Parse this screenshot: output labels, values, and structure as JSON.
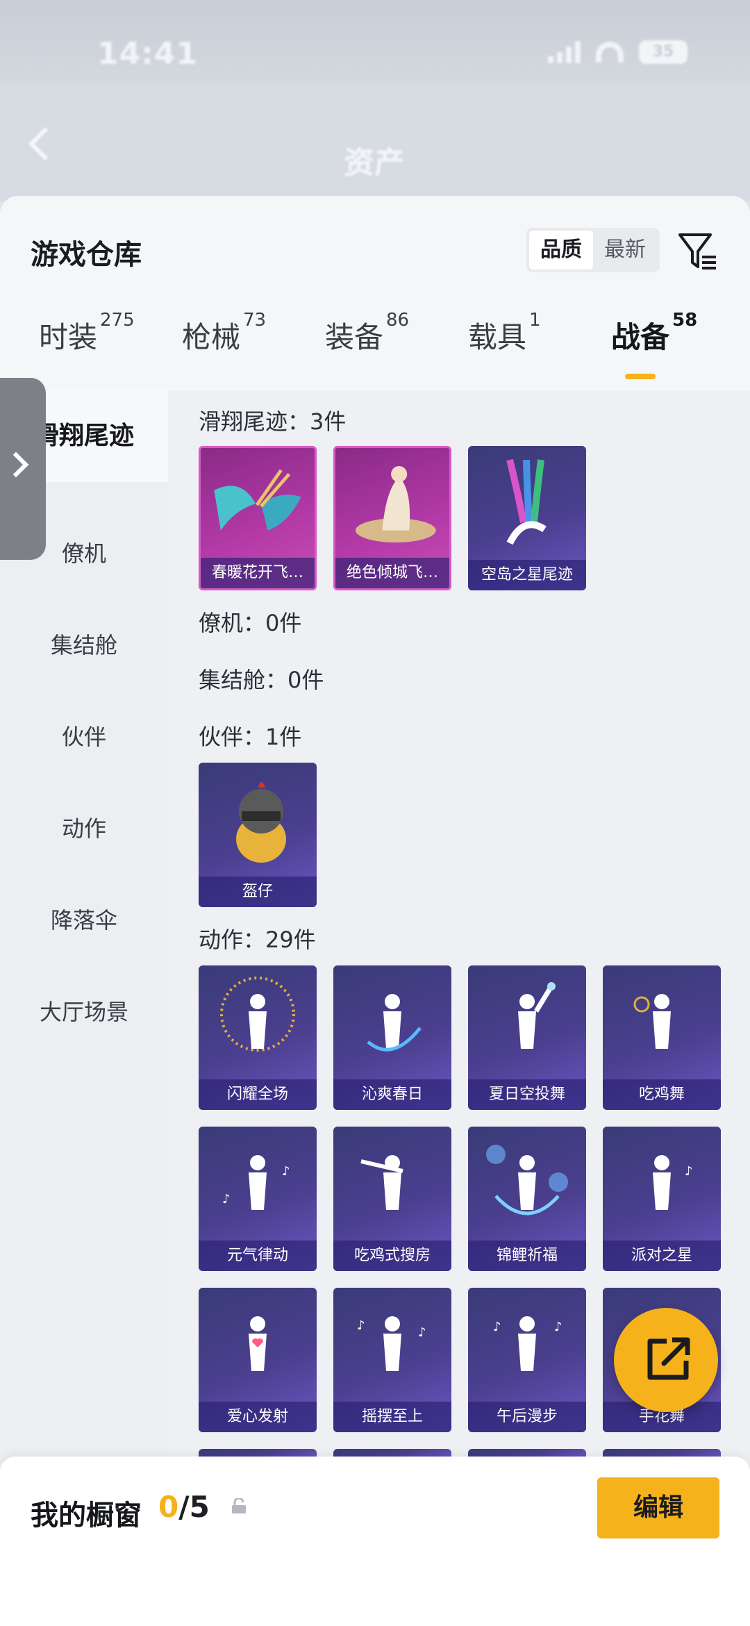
{
  "status": {
    "time": "14:41",
    "battery": "35"
  },
  "nav": {
    "title": "资产"
  },
  "warehouse": {
    "title": "游戏仓库",
    "sort": {
      "quality_label": "品质",
      "latest_label": "最新"
    }
  },
  "tabs": [
    {
      "label": "时装",
      "count": "275"
    },
    {
      "label": "枪械",
      "count": "73"
    },
    {
      "label": "装备",
      "count": "86"
    },
    {
      "label": "载具",
      "count": "1"
    },
    {
      "label": "战备",
      "count": "58"
    }
  ],
  "sidebar": {
    "items": [
      {
        "label": "滑翔尾迹"
      },
      {
        "label": "僚机"
      },
      {
        "label": "集结舱"
      },
      {
        "label": "伙伴"
      },
      {
        "label": "动作"
      },
      {
        "label": "降落伞"
      },
      {
        "label": "大厅场景"
      }
    ]
  },
  "sections": {
    "glide": {
      "title": "滑翔尾迹：3件",
      "items": [
        {
          "label": "春暖花开飞…"
        },
        {
          "label": "绝色倾城飞…"
        },
        {
          "label": "空岛之星尾迹"
        }
      ]
    },
    "wingman": {
      "title": "僚机：0件"
    },
    "pod": {
      "title": "集结舱：0件"
    },
    "partner": {
      "title": "伙伴：1件",
      "items": [
        {
          "label": "盔仔"
        }
      ]
    },
    "emote": {
      "title": "动作：29件",
      "items": [
        {
          "label": "闪耀全场"
        },
        {
          "label": "沁爽春日"
        },
        {
          "label": "夏日空投舞"
        },
        {
          "label": "吃鸡舞"
        },
        {
          "label": "元气律动"
        },
        {
          "label": "吃鸡式搜房"
        },
        {
          "label": "锦鲤祈福"
        },
        {
          "label": "派对之星"
        },
        {
          "label": "爱心发射"
        },
        {
          "label": "摇摆至上"
        },
        {
          "label": "午后漫步"
        },
        {
          "label": "手花舞"
        }
      ]
    }
  },
  "showcase": {
    "title": "我的橱窗",
    "current": "0",
    "total": "/5",
    "edit_label": "编辑"
  },
  "colors": {
    "accent": "#f6b21a",
    "card_purple": "#4b3f8f",
    "card_pink": "#b43aa8"
  }
}
